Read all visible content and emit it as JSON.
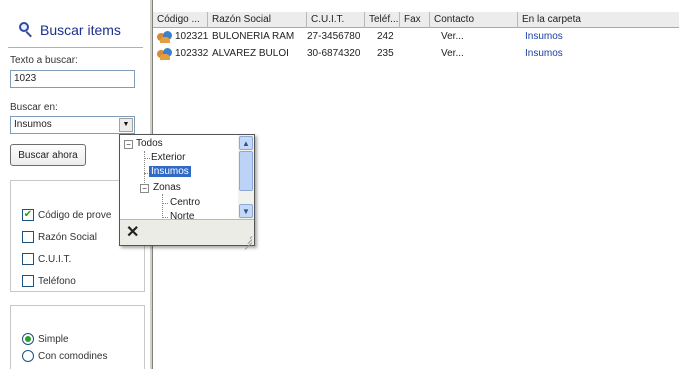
{
  "search": {
    "title": "Buscar items",
    "text_label": "Texto a buscar:",
    "text_value": "1023",
    "search_in_label": "Buscar en:",
    "search_in_value": "Insumos",
    "search_button": "Buscar ahora",
    "fields": [
      {
        "label": "Código de prove",
        "checked": true
      },
      {
        "label": "Razón Social",
        "checked": false
      },
      {
        "label": "C.U.I.T.",
        "checked": false
      },
      {
        "label": "Teléfono",
        "checked": false
      }
    ],
    "modes": [
      {
        "label": "Simple",
        "selected": true
      },
      {
        "label": "Con comodines",
        "selected": false
      }
    ]
  },
  "list": {
    "columns": [
      "Código ...",
      "Razón Social",
      "C.U.I.T.",
      "Teléf...",
      "Fax",
      "Contacto",
      "En la carpeta"
    ],
    "rows": [
      {
        "codigo": "102321",
        "razon": "BULONERIA RAM",
        "cuit": "27-3456780",
        "telefono": "242",
        "fax": "",
        "contacto": "Ver...",
        "carpeta": "Insumos"
      },
      {
        "codigo": "102332",
        "razon": "ALVAREZ BULOI",
        "cuit": "30-6874320",
        "telefono": "235",
        "fax": "",
        "contacto": "Ver...",
        "carpeta": "Insumos"
      }
    ]
  },
  "tree_popup": {
    "root": "Todos",
    "root_toggle": "−",
    "items": [
      "Exterior",
      "Insumos"
    ],
    "selected": "Insumos",
    "group": "Zonas",
    "group_toggle": "−",
    "children": [
      "Centro",
      "Norte"
    ],
    "close_glyph": "✕"
  },
  "icons": {
    "search": "magnifier-icon",
    "supplier": "people-icon"
  },
  "colors": {
    "title": "#1b2f8c",
    "selection": "#316ac5",
    "link": "#1a3faa",
    "check": "#21a121"
  }
}
